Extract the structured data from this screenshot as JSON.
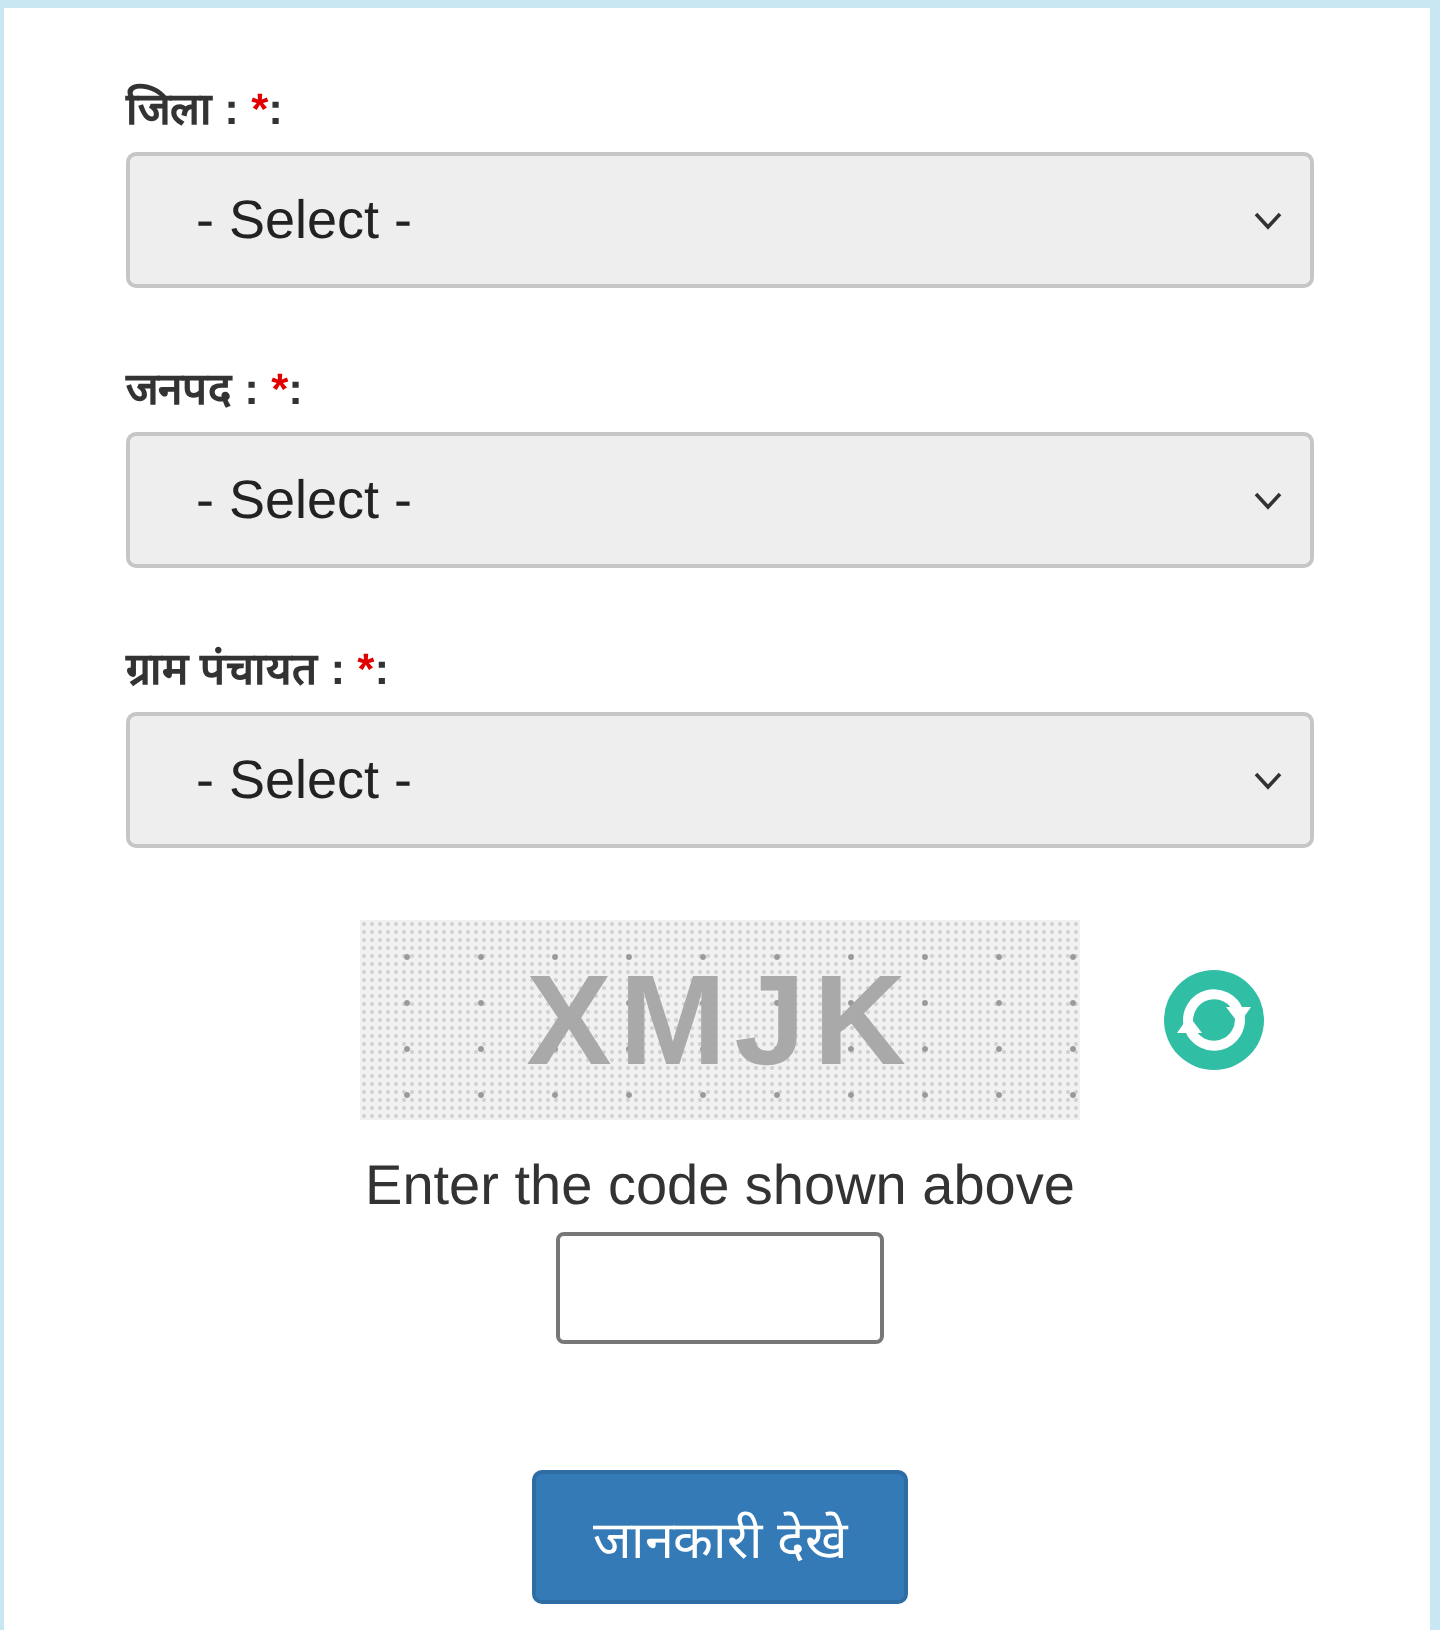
{
  "fields": [
    {
      "label": "जिला :",
      "required_mark": "*",
      "colon": ":",
      "value": "- Select -"
    },
    {
      "label": "जनपद :",
      "required_mark": "*",
      "colon": ":",
      "value": "- Select -"
    },
    {
      "label": "ग्राम पंचायत :",
      "required_mark": "*",
      "colon": ":",
      "value": "- Select -"
    }
  ],
  "captcha": {
    "code": "XMJK",
    "instruction": "Enter the code shown above"
  },
  "submit_button": {
    "label": "जानकारी देखे"
  }
}
